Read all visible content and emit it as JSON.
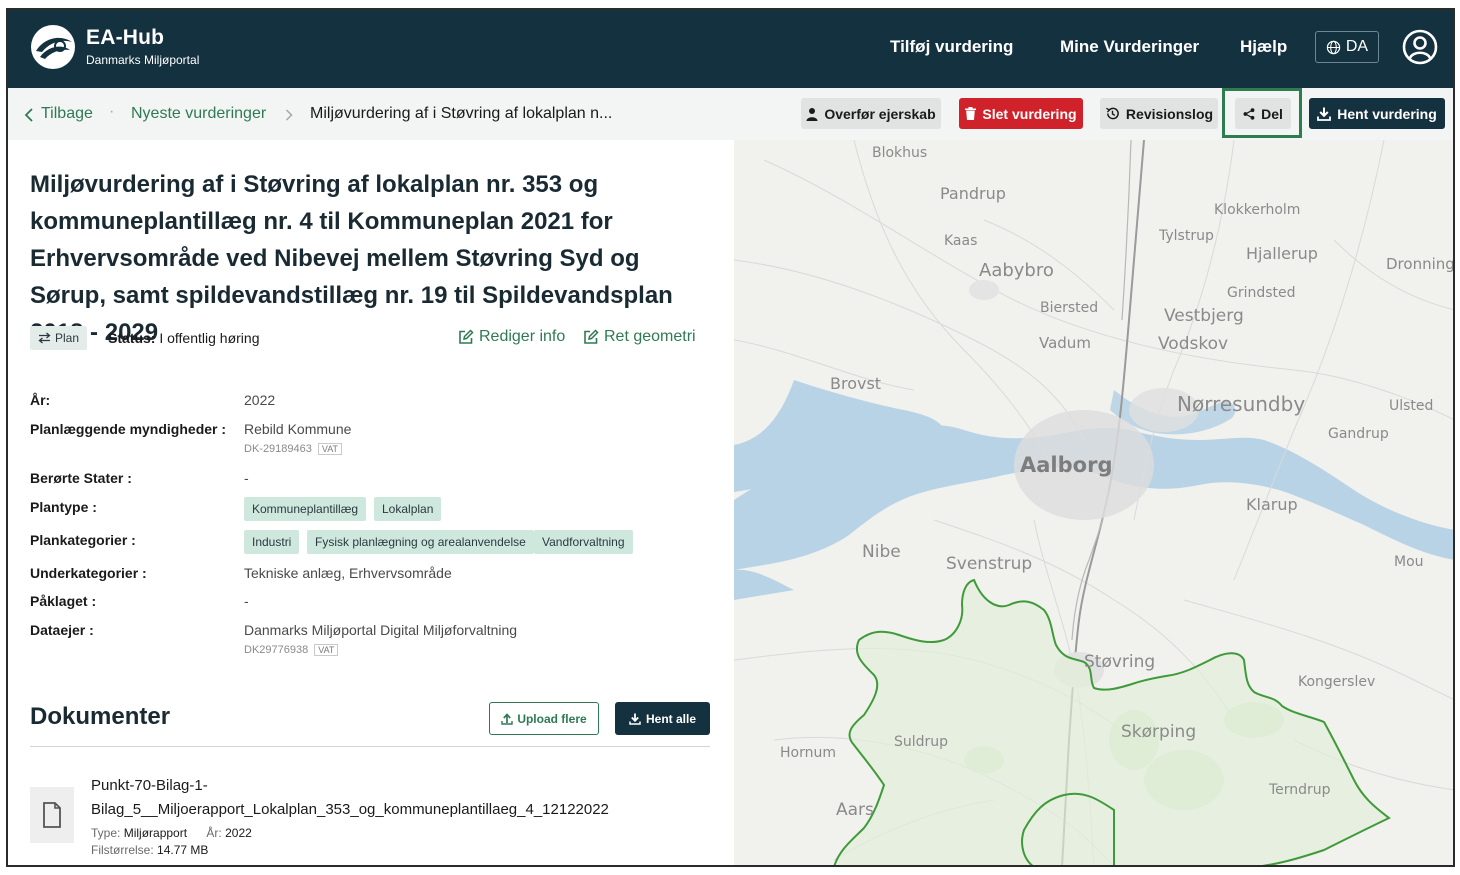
{
  "header": {
    "brand_title": "EA-Hub",
    "brand_subtitle": "Danmarks Miljøportal",
    "nav": [
      "Tilføj vurdering",
      "Mine Vurderinger",
      "Hjælp"
    ],
    "language": "DA"
  },
  "breadcrumb": {
    "back": "Tilbage",
    "parent": "Nyeste vurderinger",
    "current": "Miljøvurdering af i Støvring af lokalplan n..."
  },
  "actions": {
    "transfer": "Overfør ejerskab",
    "delete": "Slet vurdering",
    "history": "Revisionslog",
    "share": "Del",
    "download": "Hent vurdering"
  },
  "assessment": {
    "title": "Miljøvurdering af i Støvring af lokalplan nr. 353 og kommuneplantillæg nr. 4 til Kommuneplan 2021 for Erhvervsområde ved Nibevej mellem Støvring Syd og Sørup, samt spildevandstillæg nr. 19 til Spildevandsplan 2018 - 2029",
    "type_tag": "Plan",
    "status_label": "Status:",
    "status_value": "I offentlig høring",
    "edit_info": "Rediger info",
    "edit_geometry": "Ret geometri"
  },
  "details": {
    "year_label": "År:",
    "year_value": "2022",
    "authority_label": "Planlæggende myndigheder :",
    "authority_value": "Rebild Kommune",
    "authority_vat": "DK-29189463",
    "vat_tag": "VAT",
    "states_label": "Berørte Stater :",
    "states_value": "-",
    "plantype_label": "Plantype :",
    "plantypes": [
      "Kommuneplantillæg",
      "Lokalplan"
    ],
    "categories_label": "Plankategorier :",
    "categories": [
      "Industri",
      "Fysisk planlægning og arealanvendelse",
      "Vandforvaltning"
    ],
    "subcategories_label": "Underkategorier :",
    "subcategories_value": "Tekniske anlæg, Erhvervsområde",
    "appealed_label": "Påklaget :",
    "appealed_value": "-",
    "owner_label": "Dataejer :",
    "owner_value": "Danmarks Miljøportal Digital Miljøforvaltning",
    "owner_vat": "DK29776938"
  },
  "documents": {
    "title": "Dokumenter",
    "upload": "Upload flere",
    "download_all": "Hent alle",
    "file_line1": "Punkt-70-Bilag-1-",
    "file_line2": "Bilag_5__Miljoerapport_Lokalplan_353_og_kommuneplantillaeg_4_12122022",
    "type_label": "Type:",
    "type_value": "Miljørapport",
    "year_label": "År:",
    "year_value": "2022",
    "size_label": "Filstørrelse:",
    "size_value": "14.77 MB"
  },
  "map": {
    "places": [
      "Blokhus",
      "Pandrup",
      "Kaas",
      "Aabybro",
      "Klokkerholm",
      "Tylstrup",
      "Hjallerup",
      "Dronning",
      "Grindsted",
      "Biersted",
      "Vestbjerg",
      "Vadum",
      "Vodskov",
      "Brovst",
      "Nørresundby",
      "Ulsted",
      "Gandrup",
      "Aalborg",
      "Klarup",
      "Nibe",
      "Svenstrup",
      "Mou",
      "Støvring",
      "Kongerslev",
      "Skørping",
      "Suldrup",
      "Hornum",
      "Terndrup",
      "Aars"
    ]
  },
  "colors": {
    "header_bg": "#14313f",
    "accent_green": "#2f7a55",
    "danger_red": "#d0222a",
    "chip_green": "#cfe8de",
    "plan_boundary": "#3f9a3a"
  }
}
